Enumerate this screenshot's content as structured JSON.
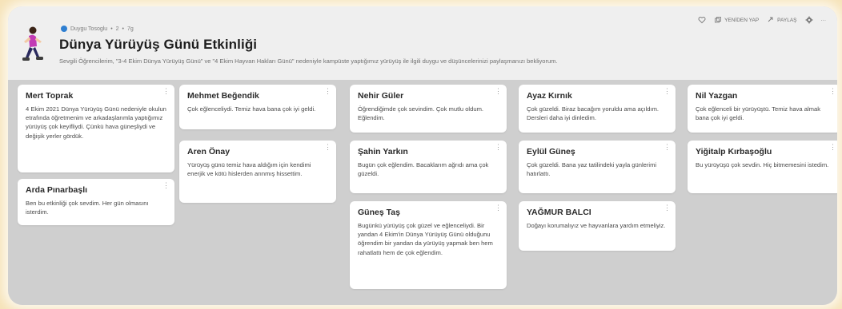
{
  "header": {
    "author": "Duygu Tosoglu",
    "meta_likes": "2",
    "meta_time": "7g",
    "title": "Dünya Yürüyüş Günü Etkinliği",
    "description": "Sevgili Öğrencilerim, \"3-4 Ekim Dünya Yürüyüş Günü\" ve \"4 Ekim Hayvan Hakları Günü\" nedeniyle kampüste yaptığımız yürüyüş ile ilgili duygu ve düşüncelerinizi paylaşmanızı bekliyorum.",
    "actions": {
      "remake": "YENİDEN YAP",
      "share": "PAYLAŞ"
    }
  },
  "posts": [
    {
      "name": "Mert Toprak",
      "text": "4 Ekim 2021 Dünya Yürüyüş Günü nedeniyle okulun etrafında öğretmenim ve arkadaşlarımla yaptığımız yürüyüş çok keyifliydi. Çünkü hava güneşliydi ve değişik yerler gördük."
    },
    {
      "name": "Arda Pınarbaşlı",
      "text": "Ben bu etkinliği çok sevdim. Her gün olmasını isterdim."
    },
    {
      "name": "Mehmet Beğendik",
      "text": "Çok eğlenceliydi. Temiz hava bana çok iyi geldi."
    },
    {
      "name": "Aren Önay",
      "text": "Yürüyüş günü temiz hava aldığım için kendimi enerjik ve kötü hislerden arınmış hissettim."
    },
    {
      "name": "Nehir Güler",
      "text": "Öğrendiğimde çok sevindim. Çok mutlu oldum. Eğlendim."
    },
    {
      "name": "Şahin Yarkın",
      "text": "Bugün çok eğlendim. Bacaklarım ağrıdı ama çok güzeldi."
    },
    {
      "name": "Güneş Taş",
      "text": "Bugünkü yürüyüş çok güzel ve eğlenceliydi. Bir yandan 4 Ekim'in Dünya Yürüyüş Günü olduğunu öğrendim bir yandan da yürüyüş yapmak ben hem rahatlattı hem de çok eğlendim."
    },
    {
      "name": "Ayaz Kırnık",
      "text": "Çok güzeldi. Biraz bacağım yoruldu ama açıldım. Dersleri daha iyi dinledim."
    },
    {
      "name": "Eylül Güneş",
      "text": "Çok güzeldi. Bana yaz tatilindeki yayla günlerimi hatırlattı."
    },
    {
      "name": "YAĞMUR BALCI",
      "text": "Doğayı korumalıyız ve hayvanlara yardım etmeliyiz."
    },
    {
      "name": "Nil Yazgan",
      "text": "Çok eğlenceli bir yürüyüştü. Temiz hava almak bana çok iyi geldi."
    },
    {
      "name": "Yiğitalp Kırbaşoğlu",
      "text": "Bu yürüyüşü çok sevdin. Hiç bitmemesini istedim."
    }
  ]
}
